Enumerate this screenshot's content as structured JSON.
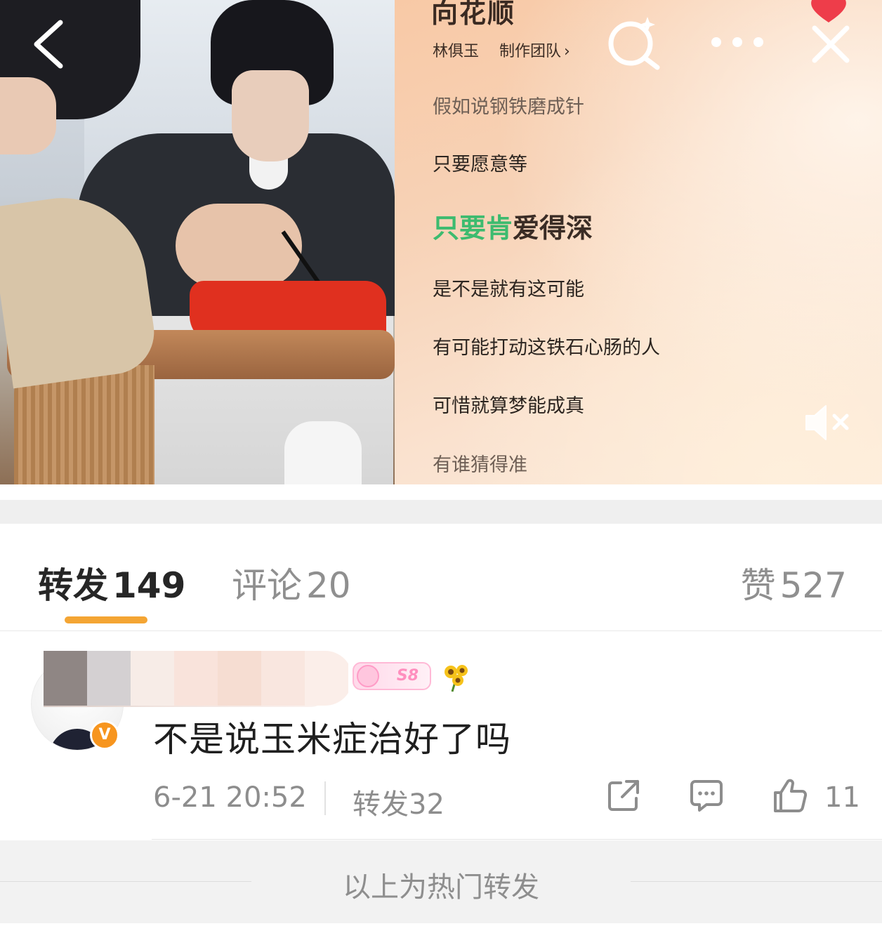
{
  "player": {
    "song_title": "向花顺",
    "artist": "林俱玉",
    "credits_label": "制作团队",
    "credits_chevron": "›",
    "lyrics": [
      {
        "text": "假如说钢铁磨成针",
        "state": "dim"
      },
      {
        "text": "只要愿意等",
        "state": "normal"
      },
      {
        "text_highlight": "只要肯",
        "text_rest": "爱得深",
        "state": "current"
      },
      {
        "text": "是不是就有这可能",
        "state": "normal"
      },
      {
        "text": "有可能打动这铁石心肠的人",
        "state": "normal"
      },
      {
        "text": "可惜就算梦能成真",
        "state": "normal"
      },
      {
        "text": "有谁猜得准",
        "state": "dim"
      }
    ],
    "icons": [
      "back-icon",
      "search-sparkle-icon",
      "more-icon",
      "close-icon",
      "heart-icon",
      "mute-icon"
    ]
  },
  "tabs": {
    "repost": {
      "label": "转发",
      "count": "149"
    },
    "comment": {
      "label": "评论",
      "count": "20"
    },
    "like": {
      "label": "赞",
      "count": "527"
    }
  },
  "repost_item": {
    "member_badge": "S8",
    "verified_mark": "V",
    "text": "不是说玉米症治好了吗",
    "time": "6-21 20:52",
    "repost_label": "转发32",
    "like_count": "11"
  },
  "footer": {
    "label": "以上为热门转发"
  },
  "colors": {
    "tab_underline": "#f4a534",
    "lyric_highlight": "#3dbb6f",
    "verified_badge": "#f7951e"
  }
}
